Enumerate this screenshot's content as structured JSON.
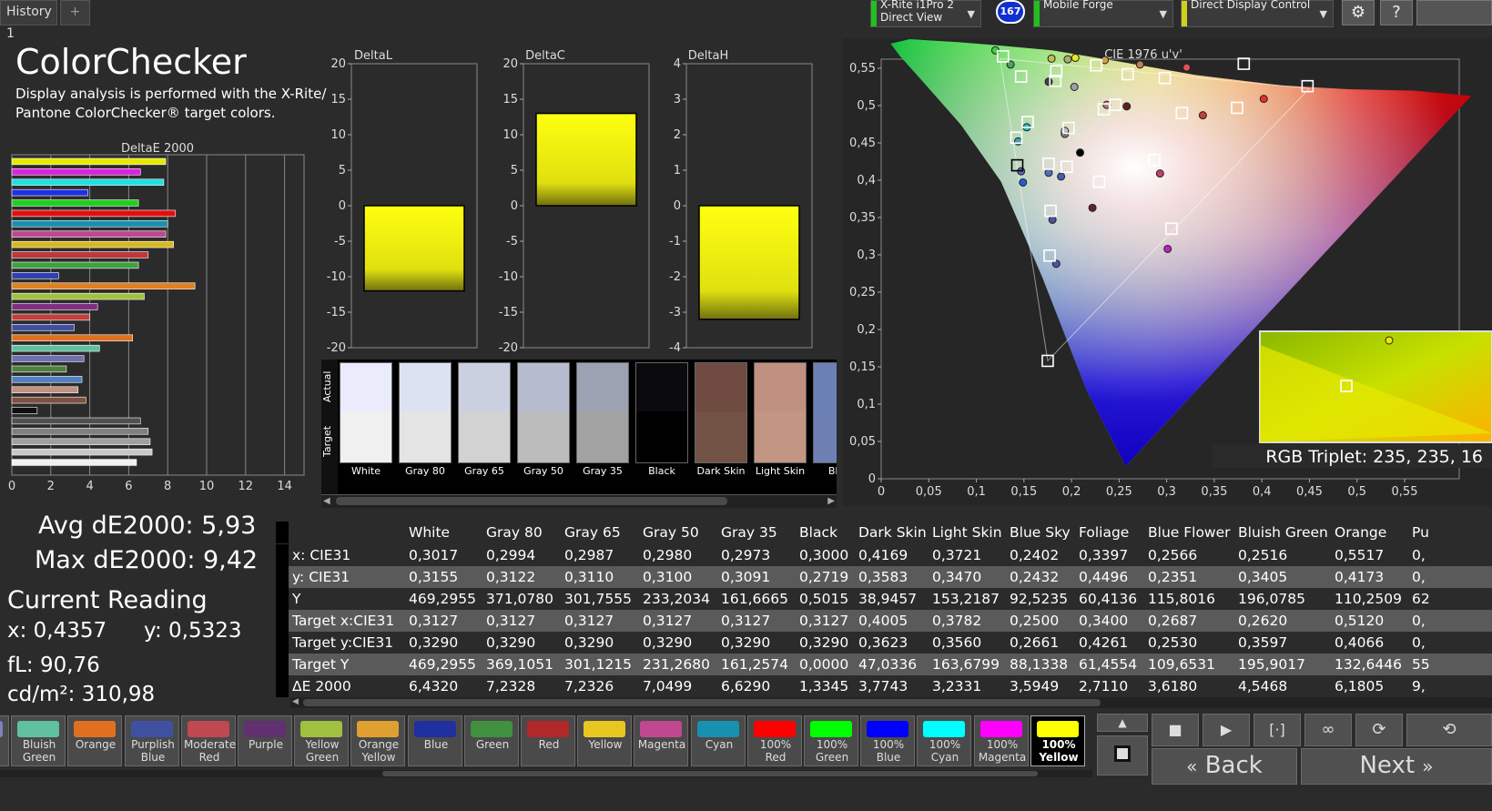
{
  "topbar": {
    "history_tab": "History 1",
    "add_tab": "+",
    "device1": {
      "line1": "X-Rite i1Pro 2",
      "line2": "Direct View",
      "color": "#20c020"
    },
    "badge": "167",
    "device2": {
      "line1": "Mobile Forge",
      "color": "#20c020"
    },
    "device3": {
      "line1": "Direct Display Control",
      "color": "#d0d020"
    },
    "settings_icon": "gear-icon",
    "help_label": "?"
  },
  "header": {
    "title": "ColorChecker",
    "desc_line1": "Display analysis is performed with the X-Rite/",
    "desc_line2": "Pantone ColorChecker® target colors."
  },
  "stats": {
    "avg": "Avg dE2000: 5,93",
    "max": "Max dE2000: 9,42",
    "current_reading": "Current Reading",
    "x": "x: 0,4357",
    "y": "y: 0,5323",
    "fl": "fL: 90,76",
    "cdm2": "cd/m²: 310,98"
  },
  "chart_data": [
    {
      "type": "bar",
      "title": "DeltaE 2000",
      "orientation": "horizontal",
      "xlim": [
        0,
        15
      ],
      "ticks": [
        "0",
        "2",
        "4",
        "6",
        "8",
        "10",
        "12",
        "14"
      ],
      "bars": [
        {
          "value": 7.9,
          "color": "#e8e800"
        },
        {
          "value": 6.6,
          "color": "#e020e0"
        },
        {
          "value": 7.8,
          "color": "#20e0e0"
        },
        {
          "value": 3.9,
          "color": "#2030e0"
        },
        {
          "value": 6.5,
          "color": "#20d020"
        },
        {
          "value": 8.4,
          "color": "#e01010"
        },
        {
          "value": 8.0,
          "color": "#1a90b0"
        },
        {
          "value": 7.9,
          "color": "#c04890"
        },
        {
          "value": 8.3,
          "color": "#d8b820"
        },
        {
          "value": 7.0,
          "color": "#c03838"
        },
        {
          "value": 6.5,
          "color": "#40a040"
        },
        {
          "value": 2.4,
          "color": "#3040b0"
        },
        {
          "value": 9.4,
          "color": "#e08020"
        },
        {
          "value": 6.8,
          "color": "#a0c040"
        },
        {
          "value": 4.4,
          "color": "#803080"
        },
        {
          "value": 4.0,
          "color": "#c04040"
        },
        {
          "value": 3.2,
          "color": "#4050a0"
        },
        {
          "value": 6.2,
          "color": "#e07020"
        },
        {
          "value": 4.5,
          "color": "#60c0a0"
        },
        {
          "value": 3.7,
          "color": "#7070b0"
        },
        {
          "value": 2.8,
          "color": "#508040"
        },
        {
          "value": 3.6,
          "color": "#5080c0"
        },
        {
          "value": 3.4,
          "color": "#c09080"
        },
        {
          "value": 3.8,
          "color": "#805040"
        },
        {
          "value": 1.3,
          "color": "#101010"
        },
        {
          "value": 6.6,
          "color": "#505050"
        },
        {
          "value": 7.0,
          "color": "#808080"
        },
        {
          "value": 7.1,
          "color": "#a0a0a0"
        },
        {
          "value": 7.2,
          "color": "#c8c8c8"
        },
        {
          "value": 6.4,
          "color": "#f0f0f0"
        }
      ]
    },
    {
      "type": "bar",
      "title": "DeltaL",
      "ylim": [
        -20,
        20
      ],
      "ticks": [
        "20",
        "15",
        "10",
        "5",
        "0",
        "-5",
        "-10",
        "-15",
        "-20"
      ],
      "value": -12
    },
    {
      "type": "bar",
      "title": "DeltaC",
      "ylim": [
        -20,
        20
      ],
      "ticks": [
        "20",
        "15",
        "10",
        "5",
        "0",
        "-5",
        "-10",
        "-15",
        "-20"
      ],
      "value": 13
    },
    {
      "type": "bar",
      "title": "DeltaH",
      "ylim": [
        -4,
        4
      ],
      "ticks": [
        "4",
        "3",
        "2",
        "1",
        "0",
        "-1",
        "-2",
        "-3",
        "-4"
      ],
      "value": -3.2
    },
    {
      "type": "scatter",
      "title": "CIE 1976 u'v'",
      "xlim": [
        0,
        0.6
      ],
      "ylim": [
        0,
        0.6
      ],
      "xticks": [
        "0",
        "0,05",
        "0,1",
        "0,15",
        "0,2",
        "0,25",
        "0,3",
        "0,35",
        "0,4",
        "0,45",
        "0,5",
        "0,55"
      ],
      "yticks": [
        "0",
        "0,05",
        "0,1",
        "0,15",
        "0,2",
        "0,25",
        "0,3",
        "0,35",
        "0,4",
        "0,45",
        "0,5",
        "0,55"
      ],
      "targets": [
        [
          0.128,
          0.566
        ],
        [
          0.147,
          0.539
        ],
        [
          0.184,
          0.546
        ],
        [
          0.226,
          0.554
        ],
        [
          0.259,
          0.542
        ],
        [
          0.298,
          0.537
        ],
        [
          0.381,
          0.556
        ],
        [
          0.448,
          0.526
        ],
        [
          0.234,
          0.495
        ],
        [
          0.246,
          0.501
        ],
        [
          0.316,
          0.49
        ],
        [
          0.374,
          0.497
        ],
        [
          0.183,
          0.533
        ],
        [
          0.154,
          0.478
        ],
        [
          0.197,
          0.47
        ],
        [
          0.142,
          0.457
        ],
        [
          0.143,
          0.42
        ],
        [
          0.176,
          0.422
        ],
        [
          0.195,
          0.418
        ],
        [
          0.229,
          0.398
        ],
        [
          0.287,
          0.427
        ],
        [
          0.178,
          0.359
        ],
        [
          0.305,
          0.335
        ],
        [
          0.177,
          0.299
        ],
        [
          0.175,
          0.158
        ]
      ],
      "measured": [
        {
          "u": 0.12,
          "v": 0.574,
          "c": "#40d040"
        },
        {
          "u": 0.136,
          "v": 0.555,
          "c": "#50a060"
        },
        {
          "u": 0.179,
          "v": 0.563,
          "c": "#c0c050"
        },
        {
          "u": 0.196,
          "v": 0.562,
          "c": "#b0b060"
        },
        {
          "u": 0.204,
          "v": 0.564,
          "c": "#e8e820"
        },
        {
          "u": 0.235,
          "v": 0.561,
          "c": "#d0a040"
        },
        {
          "u": 0.272,
          "v": 0.555,
          "c": "#c08050"
        },
        {
          "u": 0.321,
          "v": 0.551,
          "c": "#e05050"
        },
        {
          "u": 0.176,
          "v": 0.532,
          "c": "#404040"
        },
        {
          "u": 0.203,
          "v": 0.525,
          "c": "#a0a0a0"
        },
        {
          "u": 0.237,
          "v": 0.501,
          "c": "#b08080"
        },
        {
          "u": 0.258,
          "v": 0.499,
          "c": "#602020"
        },
        {
          "u": 0.338,
          "v": 0.487,
          "c": "#c04040"
        },
        {
          "u": 0.402,
          "v": 0.509,
          "c": "#e03030"
        },
        {
          "u": 0.153,
          "v": 0.471,
          "c": "#20c0c0"
        },
        {
          "u": 0.144,
          "v": 0.452,
          "c": "#40a0c0"
        },
        {
          "u": 0.193,
          "v": 0.462,
          "c": "#808080"
        },
        {
          "u": 0.193,
          "v": 0.466,
          "c": "#c0c0c0"
        },
        {
          "u": 0.209,
          "v": 0.437,
          "c": "#000000"
        },
        {
          "u": 0.147,
          "v": 0.412,
          "c": "#6060c0"
        },
        {
          "u": 0.149,
          "v": 0.397,
          "c": "#2060d0"
        },
        {
          "u": 0.176,
          "v": 0.41,
          "c": "#5070c0"
        },
        {
          "u": 0.189,
          "v": 0.405,
          "c": "#4060b0"
        },
        {
          "u": 0.222,
          "v": 0.363,
          "c": "#602040"
        },
        {
          "u": 0.293,
          "v": 0.409,
          "c": "#c04070"
        },
        {
          "u": 0.18,
          "v": 0.347,
          "c": "#5050a0"
        },
        {
          "u": 0.301,
          "v": 0.308,
          "c": "#c020c0"
        },
        {
          "u": 0.184,
          "v": 0.288,
          "c": "#5050a0"
        }
      ],
      "inset_label": "RGB Triplet: 235, 235, 16"
    }
  ],
  "swatches": [
    {
      "label": "Actual",
      "tag": "actual-label"
    },
    {
      "label": "Target",
      "tag": "target-label"
    }
  ],
  "patches": [
    {
      "name": "White",
      "actual": "#eaecfb",
      "target": "#f0f0f0"
    },
    {
      "name": "Gray 80",
      "actual": "#dde2f3",
      "target": "#e4e4e4"
    },
    {
      "name": "Gray 65",
      "actual": "#cbd0e1",
      "target": "#d2d2d2"
    },
    {
      "name": "Gray 50",
      "actual": "#b6bcce",
      "target": "#bcbcbc"
    },
    {
      "name": "Gray 35",
      "actual": "#9da2b3",
      "target": "#a2a2a2"
    },
    {
      "name": "Black",
      "actual": "#0b0b0e",
      "target": "#000000"
    },
    {
      "name": "Dark Skin",
      "actual": "#6e4a40",
      "target": "#735246"
    },
    {
      "name": "Light Skin",
      "actual": "#c09080",
      "target": "#c29682"
    },
    {
      "name": "Blue",
      "actual": "#6b80b5",
      "target": "#6d80b3"
    }
  ],
  "table": {
    "columns": [
      "",
      "White",
      "Gray 80",
      "Gray 65",
      "Gray 50",
      "Gray 35",
      "Black",
      "Dark Skin",
      "Light Skin",
      "Blue Sky",
      "Foliage",
      "Blue Flower",
      "Bluish Green",
      "Orange",
      "Pu"
    ],
    "rows": [
      [
        "x: CIE31",
        "0,3017",
        "0,2994",
        "0,2987",
        "0,2980",
        "0,2973",
        "0,3000",
        "0,4169",
        "0,3721",
        "0,2402",
        "0,3397",
        "0,2566",
        "0,2516",
        "0,5517",
        "0,"
      ],
      [
        "y: CIE31",
        "0,3155",
        "0,3122",
        "0,3110",
        "0,3100",
        "0,3091",
        "0,2719",
        "0,3583",
        "0,3470",
        "0,2432",
        "0,4496",
        "0,2351",
        "0,3405",
        "0,4173",
        "0,"
      ],
      [
        "Y",
        "469,2955",
        "371,0780",
        "301,7555",
        "233,2034",
        "161,6665",
        "0,5015",
        "38,9457",
        "153,2187",
        "92,5235",
        "60,4136",
        "115,8016",
        "196,0785",
        "110,2509",
        "62"
      ],
      [
        "Target x:CIE31",
        "0,3127",
        "0,3127",
        "0,3127",
        "0,3127",
        "0,3127",
        "0,3127",
        "0,4005",
        "0,3782",
        "0,2500",
        "0,3400",
        "0,2687",
        "0,2620",
        "0,5120",
        "0,"
      ],
      [
        "Target y:CIE31",
        "0,3290",
        "0,3290",
        "0,3290",
        "0,3290",
        "0,3290",
        "0,3290",
        "0,3623",
        "0,3560",
        "0,2661",
        "0,4261",
        "0,2530",
        "0,3597",
        "0,4066",
        "0,"
      ],
      [
        "Target Y",
        "469,2955",
        "369,1051",
        "301,1215",
        "231,2680",
        "161,2574",
        "0,0000",
        "47,0336",
        "163,6799",
        "88,1338",
        "61,4554",
        "109,6531",
        "195,9017",
        "132,6446",
        "55"
      ],
      [
        "ΔE 2000",
        "6,4320",
        "7,2328",
        "7,2326",
        "7,0499",
        "6,6290",
        "1,3345",
        "3,7743",
        "3,2331",
        "3,5949",
        "2,7110",
        "3,6180",
        "4,5468",
        "6,1805",
        "9,"
      ]
    ]
  },
  "swatch_buttons": [
    {
      "label": "er",
      "color": "#8080c0"
    },
    {
      "label": "Bluish Green",
      "color": "#60c0a0"
    },
    {
      "label": "Orange",
      "color": "#e07020"
    },
    {
      "label": "Purplish Blue",
      "color": "#4050a0"
    },
    {
      "label": "Moderate Red",
      "color": "#c04850"
    },
    {
      "label": "Purple",
      "color": "#603070"
    },
    {
      "label": "Yellow Green",
      "color": "#a0c040"
    },
    {
      "label": "Orange Yellow",
      "color": "#e0a030"
    },
    {
      "label": "Blue",
      "color": "#2030a0"
    },
    {
      "label": "Green",
      "color": "#409040"
    },
    {
      "label": "Red",
      "color": "#b02828"
    },
    {
      "label": "Yellow",
      "color": "#e8c820"
    },
    {
      "label": "Magenta",
      "color": "#c04890"
    },
    {
      "label": "Cyan",
      "color": "#1890b0"
    },
    {
      "label": "100% Red",
      "color": "#ff0000"
    },
    {
      "label": "100% Green",
      "color": "#00ff00"
    },
    {
      "label": "100% Blue",
      "color": "#0000ff"
    },
    {
      "label": "100% Cyan",
      "color": "#00ffff"
    },
    {
      "label": "100% Magenta",
      "color": "#ff00ff"
    },
    {
      "label": "100% Yellow",
      "color": "#ffff00"
    }
  ],
  "nav": {
    "back": "Back",
    "next": "Next",
    "back_icon": "double-chevron-left-icon",
    "next_icon": "double-chevron-right-icon"
  }
}
